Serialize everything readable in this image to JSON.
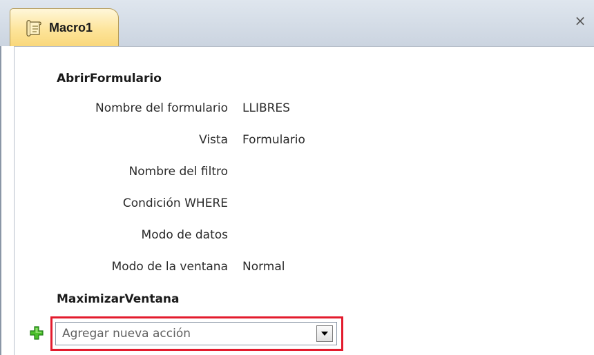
{
  "tab": {
    "title": "Macro1",
    "icon": "macro-scroll-icon",
    "close_label": "×"
  },
  "actions": [
    {
      "name": "AbrirFormulario",
      "arguments": [
        {
          "label": "Nombre del formulario",
          "value": "LLIBRES"
        },
        {
          "label": "Vista",
          "value": "Formulario"
        },
        {
          "label": "Nombre del filtro",
          "value": ""
        },
        {
          "label": "Condición WHERE",
          "value": ""
        },
        {
          "label": "Modo de datos",
          "value": ""
        },
        {
          "label": "Modo de la ventana",
          "value": "Normal"
        }
      ]
    },
    {
      "name": "MaximizarVentana",
      "arguments": []
    }
  ],
  "add_action": {
    "placeholder": "Agregar nueva acción",
    "icon": "plus-icon",
    "dropdown_icon": "chevron-down-icon",
    "highlight_color": "#e31b2d"
  }
}
